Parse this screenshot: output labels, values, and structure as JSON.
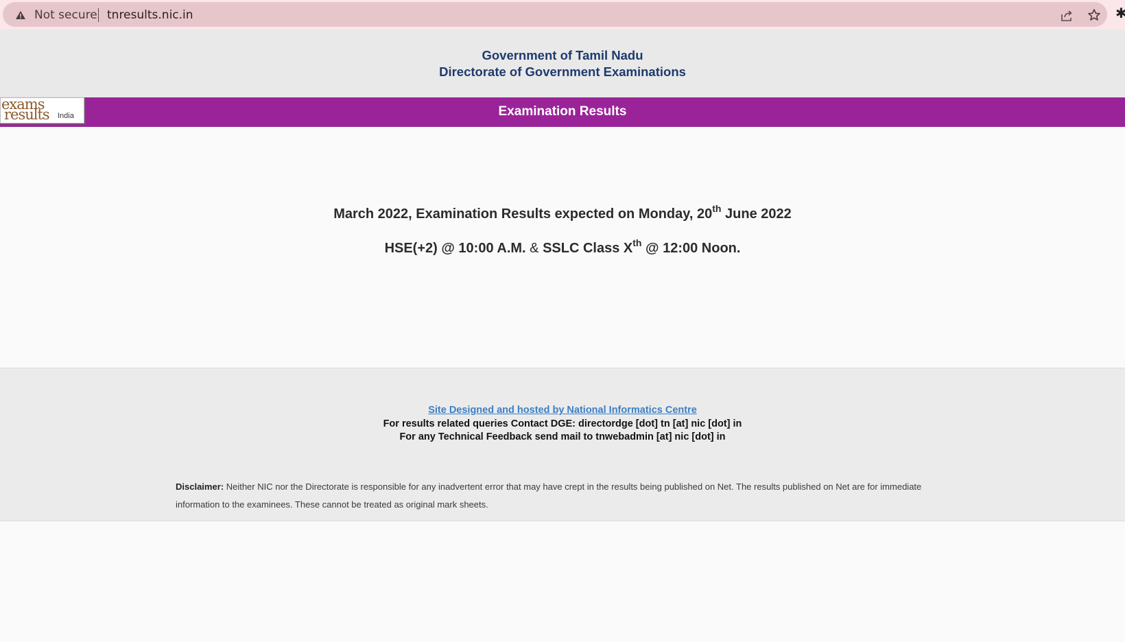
{
  "browser": {
    "security_label": "Not secure",
    "url": "tnresults.nic.in"
  },
  "header": {
    "line1": "Government of Tamil Nadu",
    "line2": "Directorate of Government Examinations"
  },
  "banner": {
    "title": "Examination Results",
    "logo": {
      "word1": "exams",
      "word2": "results",
      "word3": "India"
    }
  },
  "announcement": {
    "line1_before": "March 2022, Examination Results expected on Monday, 20",
    "line1_sup": "th",
    "line1_after": " June 2022",
    "line2_part1": "HSE(+2) @ 10:00 A.M.",
    "line2_amp": " & ",
    "line2_part2": "SSLC Class X",
    "line2_sup": "th",
    "line2_after": " @ 12:00 Noon."
  },
  "footer": {
    "nic_link": "Site Designed and hosted by National Informatics Centre",
    "contact1": "For results related queries Contact DGE:  directordge [dot] tn [at] nic [dot] in",
    "contact2": "For any Technical Feedback send mail to tnwebadmin [at] nic [dot] in",
    "disclaimer_label": "Disclaimer:",
    "disclaimer_text": " Neither NIC nor the Directorate is responsible for any inadvertent error that may have crept in the results being published on Net. The results published on Net are for immediate information to the examinees. These cannot be treated as original mark sheets."
  },
  "colors": {
    "banner": "#9b2399",
    "header_text": "#1e3a6e",
    "link": "#3a7fc7"
  }
}
